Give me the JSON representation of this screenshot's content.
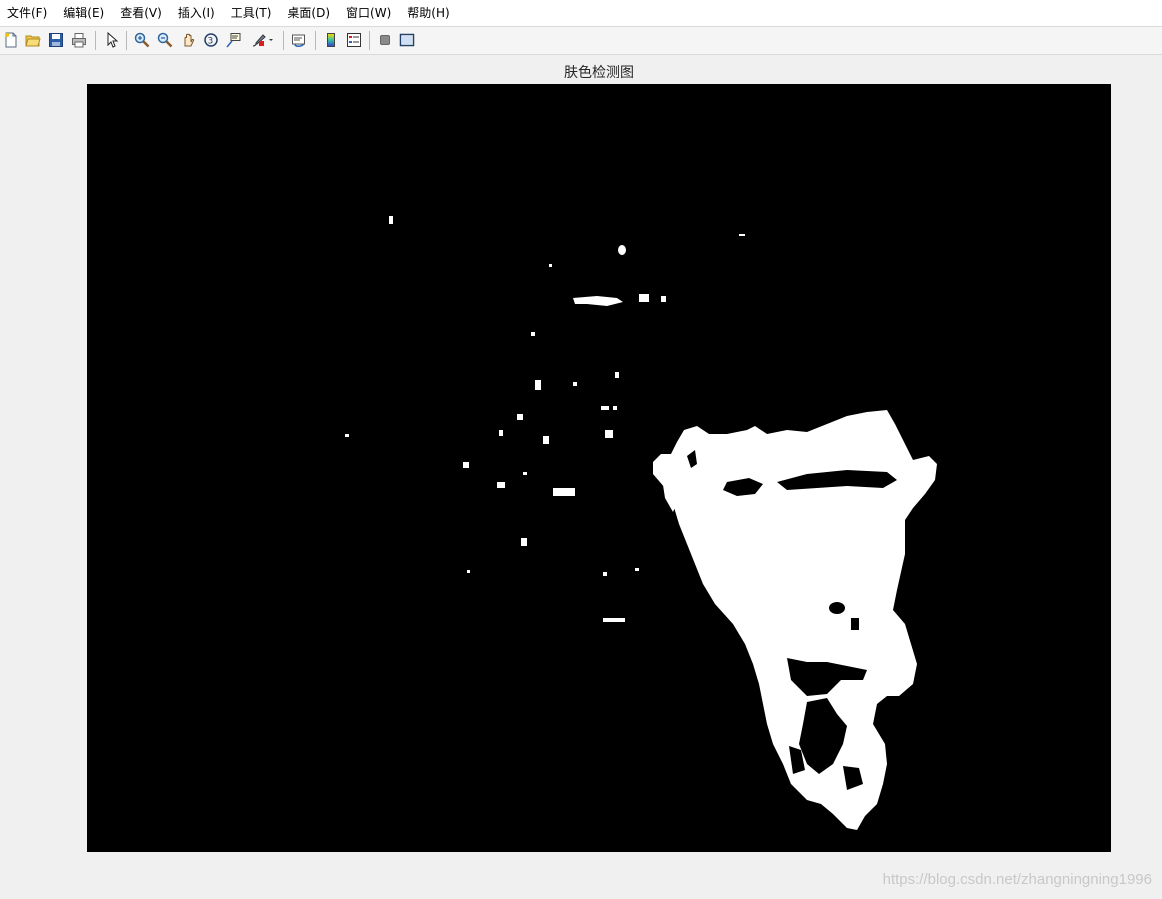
{
  "menubar": {
    "items": [
      {
        "label": "文件(F)"
      },
      {
        "label": "编辑(E)"
      },
      {
        "label": "查看(V)"
      },
      {
        "label": "插入(I)"
      },
      {
        "label": "工具(T)"
      },
      {
        "label": "桌面(D)"
      },
      {
        "label": "窗口(W)"
      },
      {
        "label": "帮助(H)"
      }
    ]
  },
  "toolbar": {
    "icons": [
      "new-figure-icon",
      "open-file-icon",
      "save-icon",
      "print-icon",
      "select-arrow-icon",
      "zoom-in-icon",
      "zoom-out-icon",
      "pan-hand-icon",
      "rotate-3d-icon",
      "data-cursor-icon",
      "brush-icon",
      "link-plot-icon",
      "colorbar-icon",
      "legend-icon",
      "hide-plot-tools-icon",
      "show-plot-tools-icon"
    ]
  },
  "figure": {
    "title": "肤色检测图",
    "background": "#000000",
    "foreground": "#ffffff"
  },
  "watermark": "https://blog.csdn.net/zhangningning1996"
}
